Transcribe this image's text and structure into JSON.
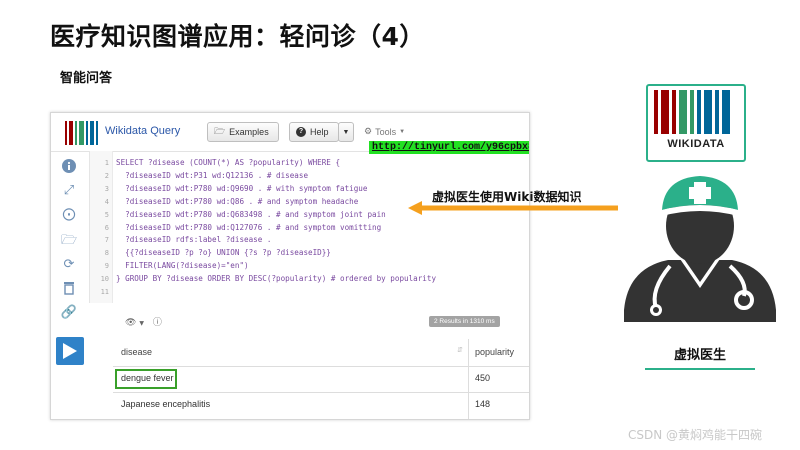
{
  "slide": {
    "title": "医疗知识图谱应用：轻问诊（4）",
    "section": "智能问答"
  },
  "query_app": {
    "name": "Wikidata Query",
    "examples_label": "Examples",
    "help_label": "Help",
    "tools_label": "Tools",
    "short_url": "http://tinyurl.com/y96cpbx8",
    "code_lines": [
      "SELECT ?disease (COUNT(*) AS ?popularity) WHERE {",
      "  ?diseaseID wdt:P31 wd:Q12136 . # disease",
      "  ?diseaseID wdt:P780 wd:Q9690 . # with symptom fatigue",
      "  ?diseaseID wdt:P780 wd:Q86 . # and symptom headache",
      "  ?diseaseID wdt:P780 wd:Q683498 . # and symptom joint pain",
      "  ?diseaseID wdt:P780 wd:Q127076 . # and symptom vomitting",
      "  ?diseaseID rdfs:label ?disease .",
      "  {{?diseaseID ?p ?o} UNION {?s ?p ?diseaseID}}",
      "  FILTER(LANG(?disease)=\"en\")",
      "} GROUP BY ?disease ORDER BY DESC(?popularity) # ordered by popularity",
      ""
    ],
    "line_numbers": [
      "1",
      "2",
      "3",
      "4",
      "5",
      "6",
      "7",
      "8",
      "9",
      "10",
      "11"
    ],
    "results_badge": "2 Results in 1310 ms",
    "table": {
      "headers": [
        "disease",
        "popularity"
      ],
      "rows": [
        [
          "dengue fever",
          "450"
        ],
        [
          "Japanese encephalitis",
          "148"
        ]
      ]
    }
  },
  "annotation": "虚拟医生使用Wiki数据知识",
  "wikidata_logo_text": "WIKIDATA",
  "doctor_label": "虚拟医生",
  "watermark": "CSDN @黄焖鸡能干四碗",
  "colors": {
    "accent_green": "#2bb08a",
    "arrow_orange": "#f5a01e",
    "url_highlight": "#22e022",
    "run_button": "#2f82c8"
  }
}
